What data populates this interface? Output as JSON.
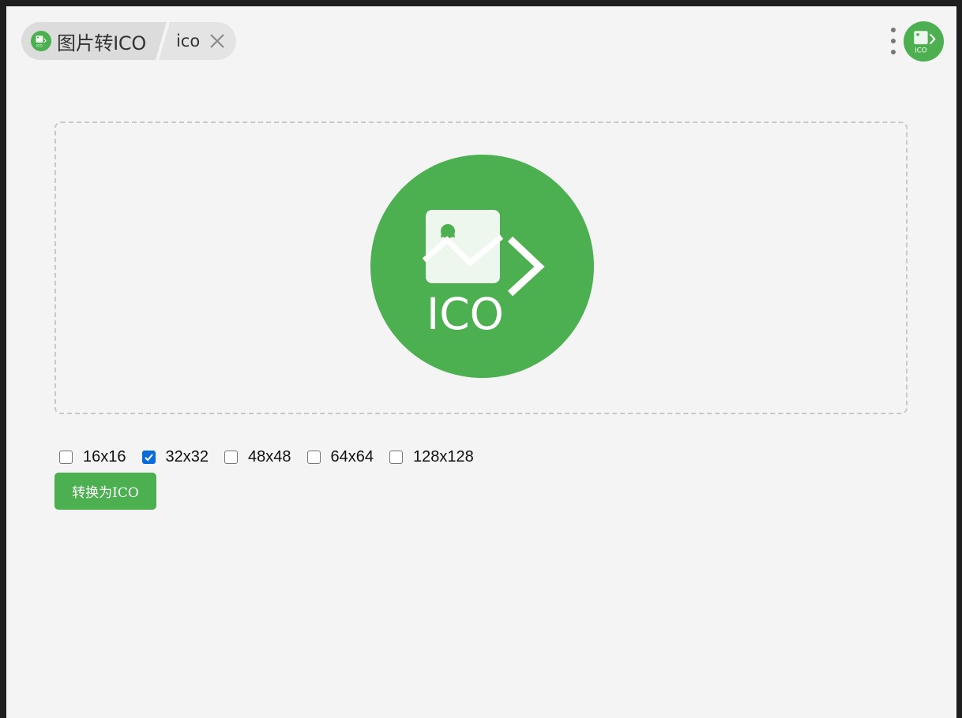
{
  "tabs": {
    "main_title": "图片转ICO",
    "sub_label": "ico"
  },
  "logo": {
    "text": "ICO",
    "color": "#4caf50"
  },
  "sizes": [
    {
      "label": "16x16",
      "checked": false
    },
    {
      "label": "32x32",
      "checked": true
    },
    {
      "label": "48x48",
      "checked": false
    },
    {
      "label": "64x64",
      "checked": false
    },
    {
      "label": "128x128",
      "checked": false
    }
  ],
  "actions": {
    "convert_label": "转换为ICO"
  },
  "icons": {
    "tab_logo": "ico-converter-icon",
    "tab_close": "close-icon",
    "menu": "more-vertical-icon",
    "app": "ico-converter-icon",
    "dropzone": "ico-converter-icon"
  }
}
